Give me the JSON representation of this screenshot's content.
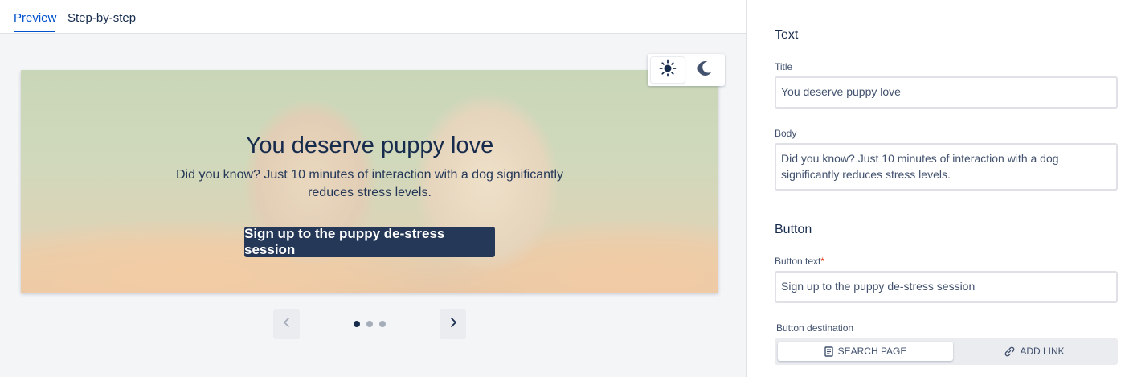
{
  "tabs": [
    {
      "label": "Preview",
      "active": true
    },
    {
      "label": "Step-by-step",
      "active": false
    }
  ],
  "theme_toggle": {
    "light_icon": "sun-icon",
    "dark_icon": "moon-icon",
    "selected": "light"
  },
  "banner": {
    "title": "You deserve puppy love",
    "body": "Did you know? Just 10 minutes of interaction with a dog significantly reduces stress levels.",
    "button_label": "Sign up to the puppy de-stress session",
    "background_image": "two golden retriever puppies in a flower field"
  },
  "carousel": {
    "prev_icon": "chevron-left-icon",
    "next_icon": "chevron-right-icon",
    "total_slides": 3,
    "current_slide": 1
  },
  "panel": {
    "text_section": "Text",
    "title_label": "Title",
    "title_value": "You deserve puppy love",
    "body_label": "Body",
    "body_value": "Did you know? Just 10 minutes of interaction with a dog significantly reduces stress levels.",
    "button_section": "Button",
    "button_text_label": "Button text",
    "required_marker": "*",
    "button_text_value": "Sign up to the puppy de-stress session",
    "destination_label": "Button destination",
    "destination_options": [
      {
        "label": "SEARCH PAGE",
        "icon": "document-icon",
        "selected": true
      },
      {
        "label": "ADD LINK",
        "icon": "link-icon",
        "selected": false
      }
    ]
  },
  "colors": {
    "accent": "#0052cc",
    "banner_button": "#253858",
    "text_primary": "#172b4d"
  }
}
